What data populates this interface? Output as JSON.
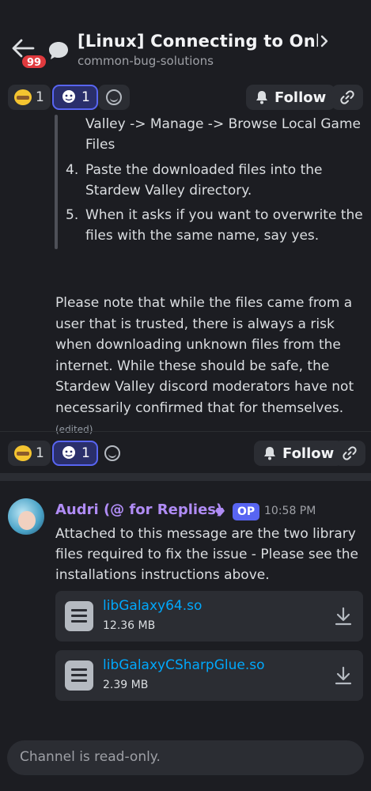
{
  "header": {
    "notification_count": "99",
    "title": "[Linux] Connecting to Onlin...",
    "subtitle": "common-bug-solutions"
  },
  "reactions_top": [
    {
      "emoji": "thanks-emoji",
      "count": "1"
    },
    {
      "emoji": "thumbs-up-emoji",
      "count": "1",
      "active": true
    }
  ],
  "reactions_bottom": [
    {
      "emoji": "thanks-emoji",
      "count": "1"
    },
    {
      "emoji": "thumbs-up-emoji",
      "count": "1",
      "active": true
    }
  ],
  "follow_label": "Follow",
  "post": {
    "step3_cont_line1": "Valley -> Manage -> Browse Local Game",
    "step3_cont_line2": "Files",
    "step4_num": "4.",
    "step4_line1": "Paste the downloaded files into the",
    "step4_line2": "Stardew Valley directory.",
    "step5_num": "5.",
    "step5_line1": "When it asks if you want to overwrite the",
    "step5_line2": "files with the same name, say yes.",
    "note": "Please note that while the files came from a user that is trusted, there is always a risk when downloading unknown files from the internet. While these should be safe, the Stardew Valley discord moderators have not necessarily confirmed that for themselves.",
    "edited_label": "(edited)"
  },
  "message": {
    "author": "Audri (@ for Replies)",
    "op_badge": "OP",
    "time": "10:58 PM",
    "text": "Attached to this message are the two library files required to fix the issue - Please see the installations instructions above.",
    "attachments": [
      {
        "name": "libGalaxy64.so",
        "size": "12.36 MB"
      },
      {
        "name": "libGalaxyCSharpGlue.so",
        "size": "2.39 MB"
      }
    ]
  },
  "composer": {
    "placeholder": "Channel is read-only."
  },
  "colors": {
    "background": "#1c1d22",
    "accent": "#5865f2",
    "author": "#b08cf5",
    "link": "#00a8fc",
    "badge": "#e03a3e"
  }
}
